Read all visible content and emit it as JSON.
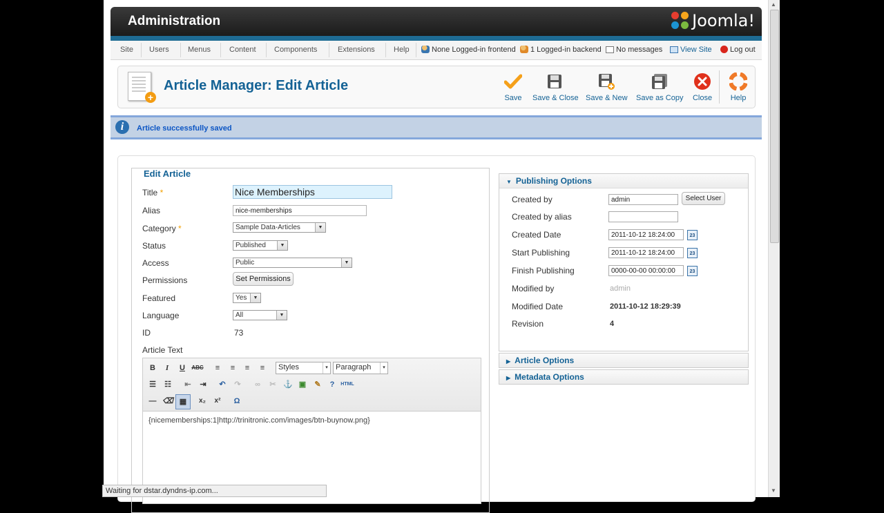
{
  "header": {
    "title": "Administration",
    "logo_text": "Joomla!"
  },
  "menu": {
    "items": [
      "Site",
      "Users",
      "Menus",
      "Content",
      "Components",
      "Extensions",
      "Help"
    ],
    "status": {
      "frontend": "None Logged-in frontend",
      "backend": "1 Logged-in backend",
      "messages": "No messages",
      "view_site": "View Site",
      "logout": "Log out"
    }
  },
  "toolbar": {
    "page_title": "Article Manager: Edit Article",
    "save": "Save",
    "save_close": "Save & Close",
    "save_new": "Save & New",
    "save_copy": "Save as Copy",
    "close": "Close",
    "help": "Help"
  },
  "message": "Article successfully saved",
  "edit": {
    "legend": "Edit Article",
    "title_label": "Title",
    "title_value": "Nice Memberships",
    "alias_label": "Alias",
    "alias_value": "nice-memberships",
    "category_label": "Category",
    "category_value": "Sample Data-Articles",
    "status_label": "Status",
    "status_value": "Published",
    "access_label": "Access",
    "access_value": "Public",
    "permissions_label": "Permissions",
    "permissions_button": "Set Permissions",
    "featured_label": "Featured",
    "featured_value": "Yes",
    "language_label": "Language",
    "language_value": "All",
    "id_label": "ID",
    "id_value": "73",
    "article_text_label": "Article Text",
    "required_mark": "*"
  },
  "editor": {
    "styles": "Styles",
    "format": "Paragraph",
    "content": "{nicememberships:1|http://trinitronic.com/images/btn-buynow.png}"
  },
  "publishing": {
    "header": "Publishing Options",
    "created_by_label": "Created by",
    "created_by_value": "admin",
    "select_user": "Select User",
    "created_by_alias_label": "Created by alias",
    "created_by_alias_value": "",
    "created_date_label": "Created Date",
    "created_date_value": "2011-10-12 18:24:00",
    "start_publishing_label": "Start Publishing",
    "start_publishing_value": "2011-10-12 18:24:00",
    "finish_publishing_label": "Finish Publishing",
    "finish_publishing_value": "0000-00-00 00:00:00",
    "modified_by_label": "Modified by",
    "modified_by_value": "admin",
    "modified_date_label": "Modified Date",
    "modified_date_value": "2011-10-12 18:29:39",
    "revision_label": "Revision",
    "revision_value": "4",
    "calendar_day": "23"
  },
  "article_options": "Article Options",
  "metadata_options": "Metadata Options",
  "browser_status": "Waiting for dstar.dyndns-ip.com...",
  "colors": {
    "header_band": "#1e6b93",
    "link_blue": "#146295",
    "message_bg": "#c3d2e5",
    "required": "#f2a000"
  }
}
